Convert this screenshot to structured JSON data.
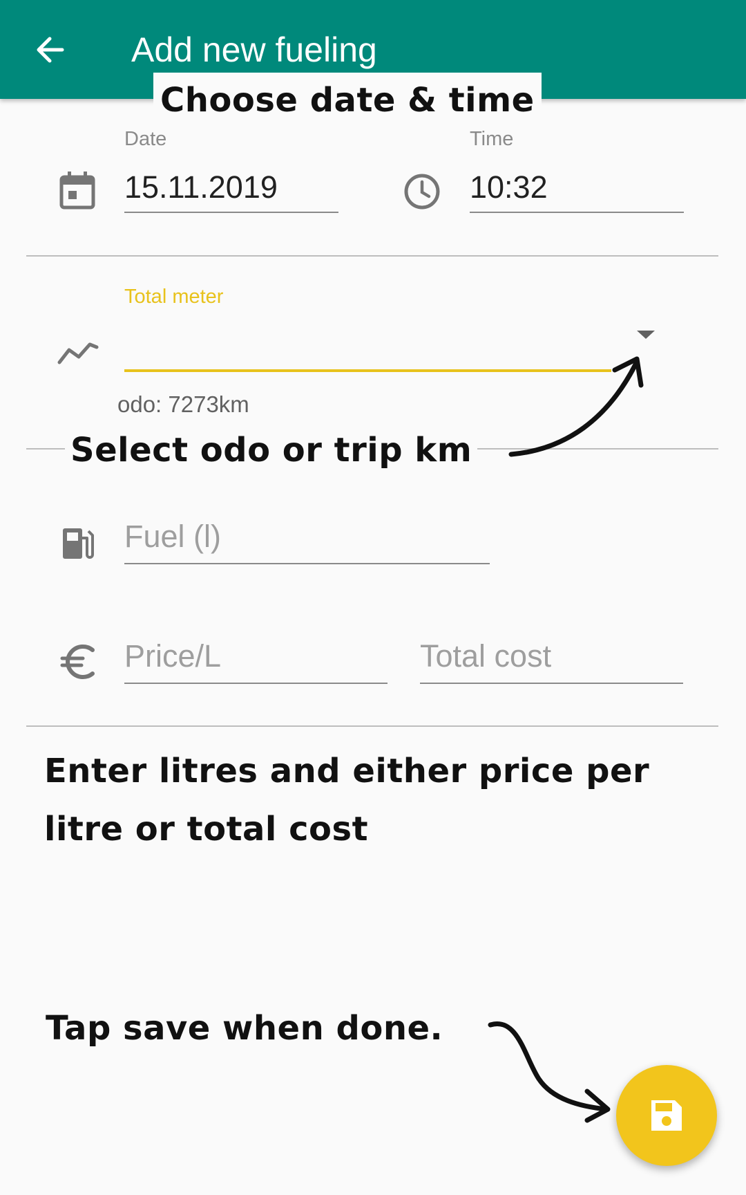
{
  "appbar": {
    "title": "Add new fueling",
    "back_icon": "arrow-back-icon",
    "color": "#00897b"
  },
  "date_field": {
    "label": "Date",
    "value": "15.11.2019",
    "icon": "calendar-icon"
  },
  "time_field": {
    "label": "Time",
    "value": "10:32",
    "icon": "clock-icon"
  },
  "meter_field": {
    "label": "Total meter",
    "value": "",
    "icon": "trend-line-icon",
    "dropdown_icon": "dropdown-arrow-icon",
    "helper": "odo: 7273km",
    "accent": "#e8c21c"
  },
  "fuel_field": {
    "placeholder": "Fuel (l)",
    "icon": "fuel-pump-icon"
  },
  "price_field": {
    "placeholder": "Price/L",
    "icon": "euro-icon"
  },
  "total_field": {
    "placeholder": "Total cost"
  },
  "annotations": {
    "date_time": "Choose date & time",
    "odo": "Select odo or trip km",
    "fuel_line1": "Enter litres and either price per",
    "fuel_line2": "litre or total cost",
    "save": "Tap save when done."
  },
  "fab": {
    "icon": "save-icon",
    "color": "#f2c51c"
  }
}
